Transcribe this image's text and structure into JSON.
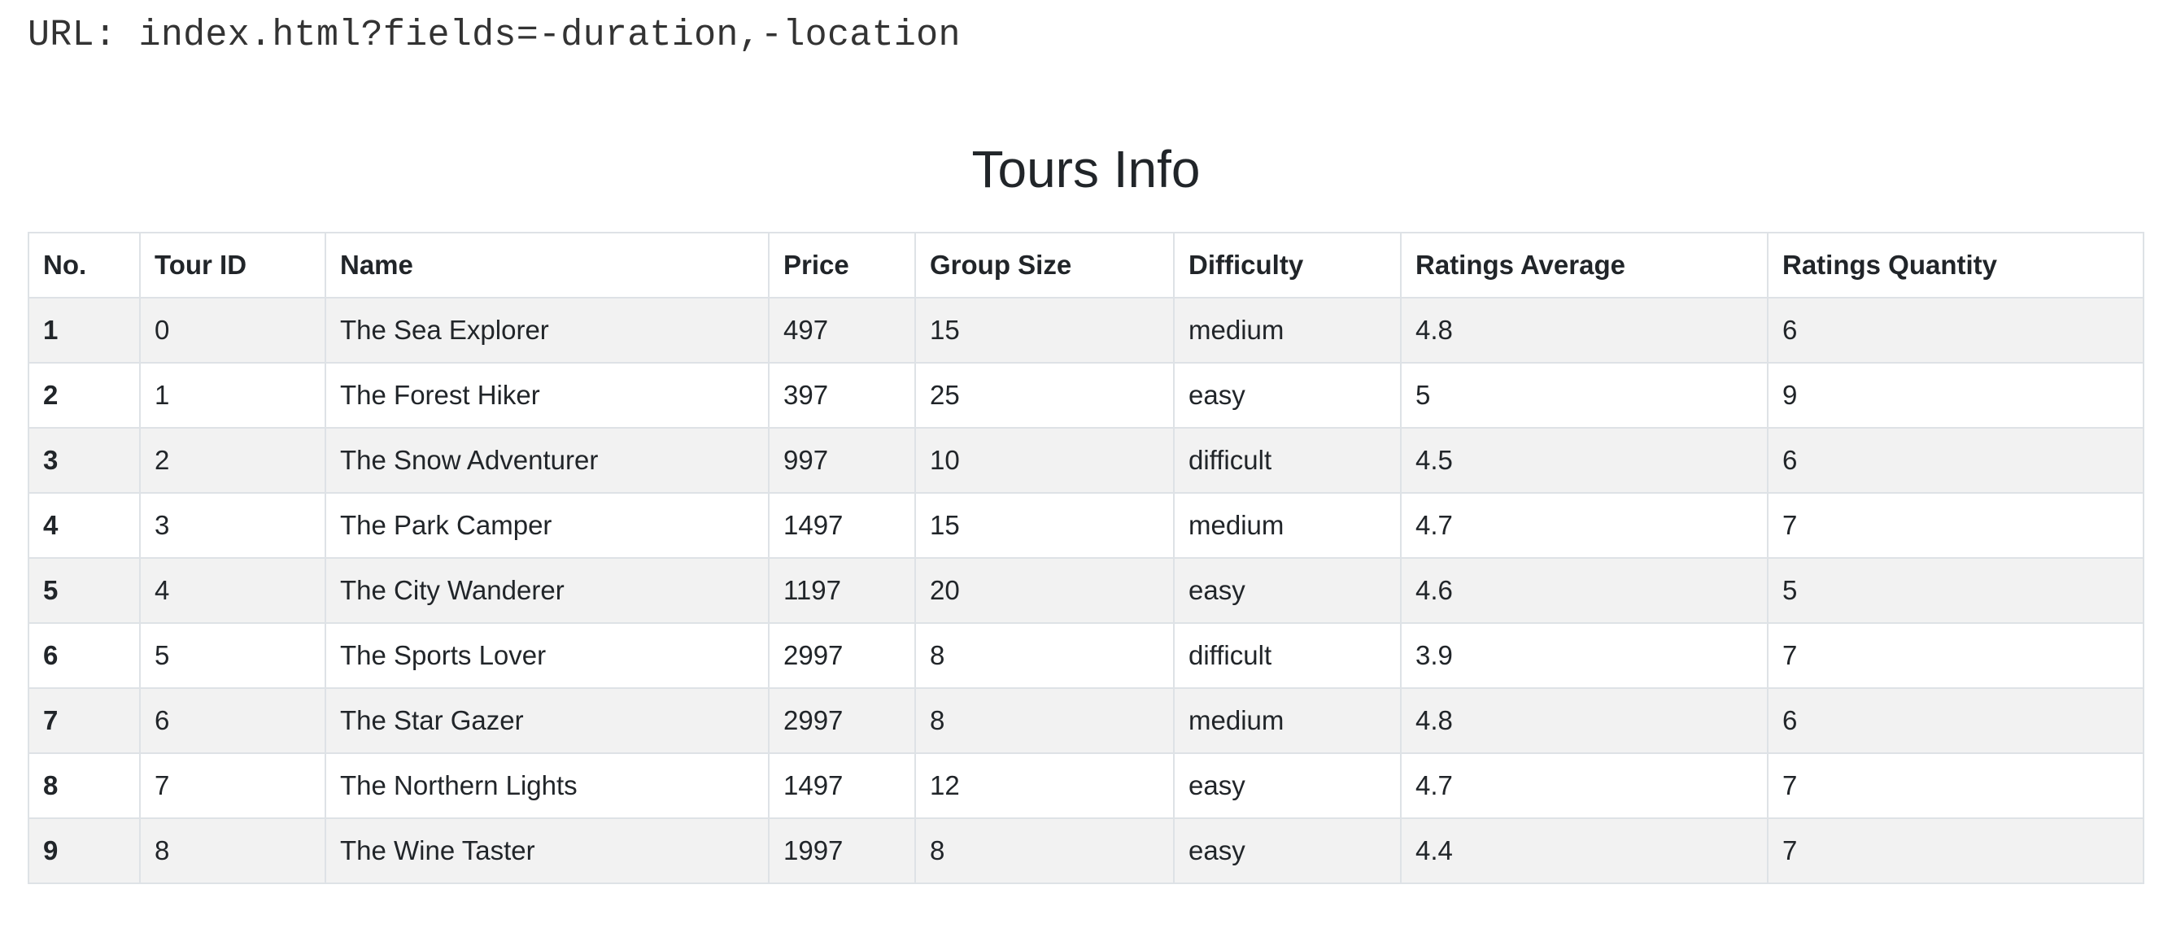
{
  "url_line": "URL: index.html?fields=-duration,-location",
  "page_title": "Tours Info",
  "table": {
    "headers": [
      "No.",
      "Tour ID",
      "Name",
      "Price",
      "Group Size",
      "Difficulty",
      "Ratings Average",
      "Ratings Quantity"
    ],
    "rows": [
      [
        "1",
        "0",
        "The Sea Explorer",
        "497",
        "15",
        "medium",
        "4.8",
        "6"
      ],
      [
        "2",
        "1",
        "The Forest Hiker",
        "397",
        "25",
        "easy",
        "5",
        "9"
      ],
      [
        "3",
        "2",
        "The Snow Adventurer",
        "997",
        "10",
        "difficult",
        "4.5",
        "6"
      ],
      [
        "4",
        "3",
        "The Park Camper",
        "1497",
        "15",
        "medium",
        "4.7",
        "7"
      ],
      [
        "5",
        "4",
        "The City Wanderer",
        "1197",
        "20",
        "easy",
        "4.6",
        "5"
      ],
      [
        "6",
        "5",
        "The Sports Lover",
        "2997",
        "8",
        "difficult",
        "3.9",
        "7"
      ],
      [
        "7",
        "6",
        "The Star Gazer",
        "2997",
        "8",
        "medium",
        "4.8",
        "6"
      ],
      [
        "8",
        "7",
        "The Northern Lights",
        "1497",
        "12",
        "easy",
        "4.7",
        "7"
      ],
      [
        "9",
        "8",
        "The Wine Taster",
        "1997",
        "8",
        "easy",
        "4.4",
        "7"
      ]
    ]
  }
}
